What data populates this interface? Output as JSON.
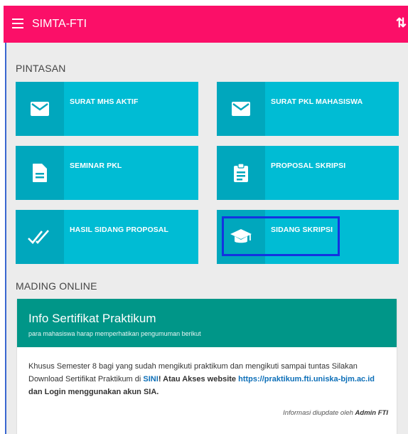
{
  "app": {
    "title": "SIMTA-FTI"
  },
  "sections": {
    "shortcuts": "PINTASAN",
    "board": "MADING ONLINE"
  },
  "tiles": [
    {
      "label": "SURAT MHS AKTIF",
      "icon": "mail-icon"
    },
    {
      "label": "SURAT PKL MAHASISWA",
      "icon": "mail-icon"
    },
    {
      "label": "SEMINAR PKL",
      "icon": "document-icon"
    },
    {
      "label": "PROPOSAL SKRIPSI",
      "icon": "clipboard-icon"
    },
    {
      "label": "HASIL SIDANG PROPOSAL",
      "icon": "double-check-icon"
    },
    {
      "label": "SIDANG SKRIPSI",
      "icon": "graduation-cap-icon"
    }
  ],
  "announcement": {
    "title": "Info Sertifikat Praktikum",
    "subtitle": "para mahasiswa harap memperhatikan pengumuman berikut",
    "text_1": "Khusus Semester 8 bagi yang sudah mengikuti praktikum dan mengikuti sampai tuntas Silakan Download Sertifikat Praktikum di ",
    "link_sini": "SINI",
    "text_2": "! Atau Akses website ",
    "link_site": "https://praktikum.fti.uniska-bjm.ac.id",
    "text_3": " dan Login menggunakan akun SIA.",
    "updated_by_prefix": "Informasi diupdate oleh ",
    "updated_by": "Admin FTI"
  },
  "colors": {
    "topbar": "#fb0f68",
    "tile": "#00bcd4",
    "tile_icon_bg": "#00a7bd",
    "card_header": "#009688",
    "highlight": "#1333e0"
  }
}
